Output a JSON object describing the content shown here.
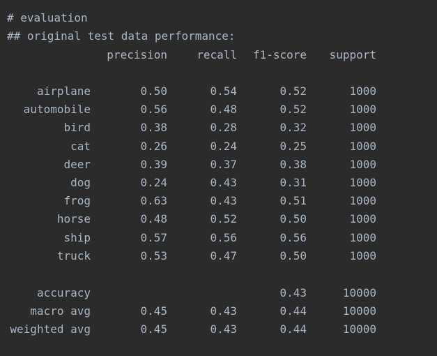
{
  "output": {
    "heading1": "# evaluation",
    "heading2": "## original test data performance:",
    "columns": {
      "precision": "precision",
      "recall": "recall",
      "f1": "f1-score",
      "support": "support"
    },
    "class_rows": [
      {
        "label": "airplane",
        "precision": "0.50",
        "recall": "0.54",
        "f1": "0.52",
        "support": "1000"
      },
      {
        "label": "automobile",
        "precision": "0.56",
        "recall": "0.48",
        "f1": "0.52",
        "support": "1000"
      },
      {
        "label": "bird",
        "precision": "0.38",
        "recall": "0.28",
        "f1": "0.32",
        "support": "1000"
      },
      {
        "label": "cat",
        "precision": "0.26",
        "recall": "0.24",
        "f1": "0.25",
        "support": "1000"
      },
      {
        "label": "deer",
        "precision": "0.39",
        "recall": "0.37",
        "f1": "0.38",
        "support": "1000"
      },
      {
        "label": "dog",
        "precision": "0.24",
        "recall": "0.43",
        "f1": "0.31",
        "support": "1000"
      },
      {
        "label": "frog",
        "precision": "0.63",
        "recall": "0.43",
        "f1": "0.51",
        "support": "1000"
      },
      {
        "label": "horse",
        "precision": "0.48",
        "recall": "0.52",
        "f1": "0.50",
        "support": "1000"
      },
      {
        "label": "ship",
        "precision": "0.57",
        "recall": "0.56",
        "f1": "0.56",
        "support": "1000"
      },
      {
        "label": "truck",
        "precision": "0.53",
        "recall": "0.47",
        "f1": "0.50",
        "support": "1000"
      }
    ],
    "summary_rows": [
      {
        "label": "accuracy",
        "precision": "",
        "recall": "",
        "f1": "0.43",
        "support": "10000"
      },
      {
        "label": "macro avg",
        "precision": "0.45",
        "recall": "0.43",
        "f1": "0.44",
        "support": "10000"
      },
      {
        "label": "weighted avg",
        "precision": "0.45",
        "recall": "0.43",
        "f1": "0.44",
        "support": "10000"
      }
    ]
  },
  "colors": {
    "background": "#2b2b2b",
    "text": "#a9b7c6"
  }
}
